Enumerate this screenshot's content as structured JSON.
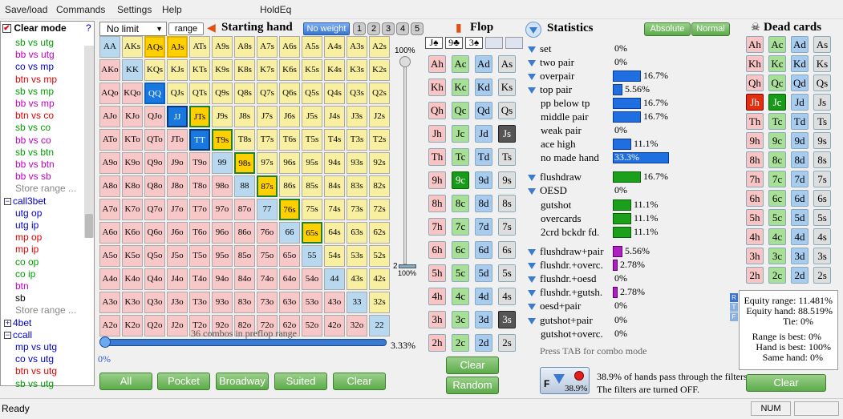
{
  "app_title": "HoldEq",
  "menu": [
    "Save/load",
    "Commands",
    "Settings",
    "Help"
  ],
  "left_panel": {
    "clear_mode_label": "Clear mode",
    "help": "?",
    "items": [
      {
        "text": "sb vs utg",
        "color": "green",
        "indent": 1
      },
      {
        "text": "bb vs utg",
        "color": "purple",
        "indent": 1
      },
      {
        "text": "co vs mp",
        "color": "blue",
        "indent": 1
      },
      {
        "text": "btn vs mp",
        "color": "red",
        "indent": 1
      },
      {
        "text": "sb vs mp",
        "color": "green",
        "indent": 1
      },
      {
        "text": "bb vs mp",
        "color": "purple",
        "indent": 1
      },
      {
        "text": "btn vs co",
        "color": "red",
        "indent": 1
      },
      {
        "text": "sb vs co",
        "color": "green",
        "indent": 1
      },
      {
        "text": "bb vs co",
        "color": "purple",
        "indent": 1
      },
      {
        "text": "sb vs btn",
        "color": "green",
        "indent": 1
      },
      {
        "text": "bb vs btn",
        "color": "purple",
        "indent": 1
      },
      {
        "text": "bb vs sb",
        "color": "purple",
        "indent": 1
      },
      {
        "text": "Store range ...",
        "color": "gray",
        "indent": 1
      },
      {
        "text": "call3bet",
        "color": "blue",
        "indent": 0,
        "expander": "minus"
      },
      {
        "text": "utg op",
        "color": "blue",
        "indent": 1
      },
      {
        "text": "utg ip",
        "color": "blue",
        "indent": 1
      },
      {
        "text": "mp op",
        "color": "red",
        "indent": 1
      },
      {
        "text": "mp ip",
        "color": "red",
        "indent": 1
      },
      {
        "text": "co op",
        "color": "green",
        "indent": 1
      },
      {
        "text": "co ip",
        "color": "green",
        "indent": 1
      },
      {
        "text": "btn",
        "color": "purple",
        "indent": 1
      },
      {
        "text": "sb",
        "color": "black",
        "indent": 1
      },
      {
        "text": "Store range ...",
        "color": "gray",
        "indent": 1
      },
      {
        "text": "4bet",
        "color": "blue",
        "indent": 0,
        "expander": "plus"
      },
      {
        "text": "ccall",
        "color": "blue",
        "indent": 0,
        "expander": "minus"
      },
      {
        "text": "mp vs utg",
        "color": "blue",
        "indent": 1
      },
      {
        "text": "co vs utg",
        "color": "blue",
        "indent": 1
      },
      {
        "text": "btn vs utg",
        "color": "red",
        "indent": 1
      },
      {
        "text": "sb vs utg",
        "color": "green",
        "indent": 1
      }
    ]
  },
  "range_header": {
    "limit_select": "No limit",
    "range_button": "range",
    "starting_hand_title": "Starting hand",
    "no_weight_button": "No weight",
    "weight_buttons": [
      "1",
      "2",
      "3",
      "4",
      "5"
    ]
  },
  "grid": {
    "ranks": [
      "A",
      "K",
      "Q",
      "J",
      "T",
      "9",
      "8",
      "7",
      "6",
      "5",
      "4",
      "3",
      "2"
    ],
    "selected_suited": [
      "AQs",
      "AJs",
      "JTs",
      "T9s",
      "98s",
      "87s",
      "76s",
      "65s"
    ],
    "selected_pairs": [
      "QQ",
      "JJ",
      "TT"
    ],
    "highlighted": [
      "JJ",
      "JTs",
      "TT",
      "T9s",
      "98s",
      "87s",
      "76s",
      "65s"
    ]
  },
  "combos_label": "36 combos in preflop range",
  "slider_left_value": "0%",
  "slider_right_value": "3.33%",
  "weight_slider": {
    "top": "100%",
    "bottom_label": "2",
    "bottom": "100%"
  },
  "bottom_buttons": [
    "All",
    "Pocket",
    "Broadway",
    "Suited",
    "Clear"
  ],
  "flop": {
    "title": "Flop",
    "board": [
      "J♠",
      "9♣",
      "3♠"
    ],
    "ranks": [
      "A",
      "K",
      "Q",
      "J",
      "T",
      "9",
      "8",
      "7",
      "6",
      "5",
      "4",
      "3",
      "2"
    ],
    "suits": [
      "h",
      "c",
      "d",
      "s"
    ],
    "selected": [
      "Js",
      "9c",
      "3s"
    ],
    "clear_button": "Clear",
    "random_button": "Random"
  },
  "statistics": {
    "title": "Statistics",
    "absolute_button": "Absolute",
    "normal_button": "Normal",
    "rows": [
      {
        "label": "set",
        "value": "0%",
        "bar": 0,
        "color": "blue",
        "filter": true
      },
      {
        "label": "two pair",
        "value": "0%",
        "bar": 0,
        "color": "blue",
        "filter": true
      },
      {
        "label": "overpair",
        "value": "16.7%",
        "bar": 0.167,
        "color": "blue",
        "filter": true
      },
      {
        "label": "top pair",
        "value": "5.56%",
        "bar": 0.0556,
        "color": "blue",
        "filter": true
      },
      {
        "label": "pp below tp",
        "value": "16.7%",
        "bar": 0.167,
        "color": "blue",
        "filter": false
      },
      {
        "label": "middle pair",
        "value": "16.7%",
        "bar": 0.167,
        "color": "blue",
        "filter": false
      },
      {
        "label": "weak pair",
        "value": "0%",
        "bar": 0,
        "color": "blue",
        "filter": false
      },
      {
        "label": "ace high",
        "value": "11.1%",
        "bar": 0.111,
        "color": "blue",
        "filter": false
      },
      {
        "label": "no made hand",
        "value": "33.3%",
        "bar": 0.333,
        "color": "blue",
        "filter": false
      },
      {
        "label": "flushdraw",
        "value": "16.7%",
        "bar": 0.167,
        "color": "green",
        "filter": true
      },
      {
        "label": "OESD",
        "value": "0%",
        "bar": 0,
        "color": "green",
        "filter": true
      },
      {
        "label": "gutshot",
        "value": "11.1%",
        "bar": 0.111,
        "color": "green",
        "filter": false
      },
      {
        "label": "overcards",
        "value": "11.1%",
        "bar": 0.111,
        "color": "green",
        "filter": false
      },
      {
        "label": "2crd bckdr fd.",
        "value": "11.1%",
        "bar": 0.111,
        "color": "green",
        "filter": false
      },
      {
        "label": "flushdraw+pair",
        "value": "5.56%",
        "bar": 0.0556,
        "color": "purple",
        "filter": true
      },
      {
        "label": "flushdr.+overc.",
        "value": "2.78%",
        "bar": 0.0278,
        "color": "purple",
        "filter": true
      },
      {
        "label": "flushdr.+oesd",
        "value": "0%",
        "bar": 0,
        "color": "purple",
        "filter": true
      },
      {
        "label": "flushdr.+gutsh.",
        "value": "2.78%",
        "bar": 0.0278,
        "color": "purple",
        "filter": true
      },
      {
        "label": "oesd+pair",
        "value": "0%",
        "bar": 0,
        "color": "purple",
        "filter": true
      },
      {
        "label": "gutshot+pair",
        "value": "0%",
        "bar": 0,
        "color": "purple",
        "filter": true
      },
      {
        "label": "gutshot+overc.",
        "value": "0%",
        "bar": 0,
        "color": "purple",
        "filter": false
      }
    ],
    "tab_hint": "Press TAB for combo mode",
    "filter_pct": "38.9%",
    "filter_text_1": "38.9% of hands pass through the filters.",
    "filter_text_2": "The filters are turned OFF."
  },
  "dead_cards": {
    "title": "Dead cards",
    "selected": [
      "Jh",
      "Jc"
    ],
    "clear_button": "Clear"
  },
  "equity": {
    "range": "Equity range: 11.481%",
    "hand": "Equity hand: 88.519%",
    "tie": "Tie: 0%",
    "range_best": "Range is best: 0%",
    "hand_best": "Hand is best: 100%",
    "same_hand": "Same hand: 0%",
    "tabs": [
      "R",
      "T",
      "F"
    ]
  },
  "status": {
    "text": "Ready",
    "num": "NUM"
  }
}
